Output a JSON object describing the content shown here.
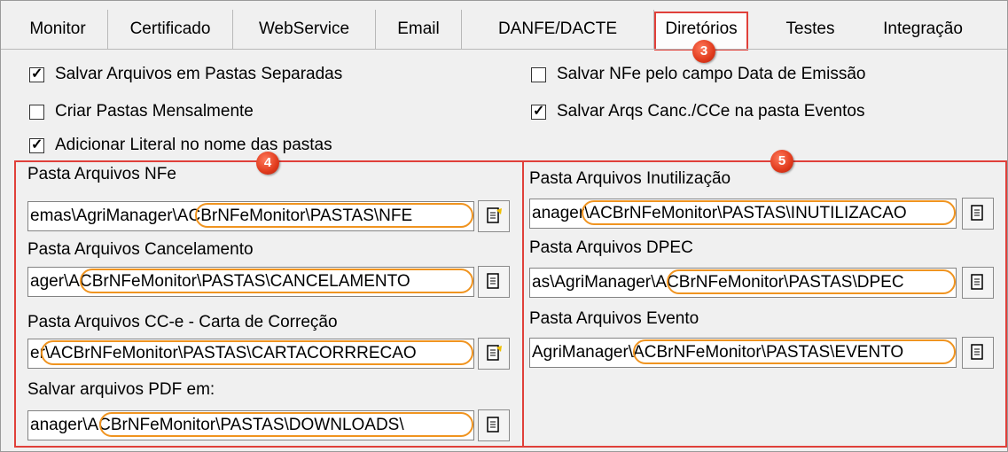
{
  "tabs": [
    "Monitor",
    "Certificado",
    "WebService",
    "Email",
    "DANFE/DACTE",
    "Diretórios",
    "Testes",
    "Integração"
  ],
  "badges": {
    "tab": "3",
    "left": "4",
    "right": "5"
  },
  "checkboxes": [
    {
      "label": "Salvar Arquivos em Pastas Separadas",
      "checked": true
    },
    {
      "label": "Criar Pastas Mensalmente",
      "checked": false
    },
    {
      "label": "Adicionar Literal no nome das pastas",
      "checked": true
    },
    {
      "label": "Salvar NFe pelo campo Data de Emissão",
      "checked": false
    },
    {
      "label": "Salvar Arqs Canc./CCe na pasta Eventos",
      "checked": true
    }
  ],
  "check_mark": "✓",
  "fields_left": [
    {
      "label": "Pasta Arquivos NFe",
      "value": "emas\\AgriManager\\ACBrNFeMonitor\\PASTAS\\NFE"
    },
    {
      "label": "Pasta Arquivos Cancelamento",
      "value": "ager\\ACBrNFeMonitor\\PASTAS\\CANCELAMENTO"
    },
    {
      "label": "Pasta Arquivos CC-e - Carta de Correção",
      "value": "er\\ACBrNFeMonitor\\PASTAS\\CARTACORRRECAO"
    },
    {
      "label": "Salvar arquivos PDF em:",
      "value": "anager\\ACBrNFeMonitor\\PASTAS\\DOWNLOADS\\"
    }
  ],
  "fields_right": [
    {
      "label": "Pasta Arquivos Inutilização",
      "value": "anager\\ACBrNFeMonitor\\PASTAS\\INUTILIZACAO"
    },
    {
      "label": "Pasta Arquivos DPEC",
      "value": "as\\AgriManager\\ACBrNFeMonitor\\PASTAS\\DPEC"
    },
    {
      "label": "Pasta Arquivos Evento",
      "value": "AgriManager\\ACBrNFeMonitor\\PASTAS\\EVENTO"
    }
  ],
  "colors": {
    "highlight": "#e0403a",
    "oval": "#f09420"
  },
  "icons": {
    "browse": "folder-browse-icon"
  }
}
